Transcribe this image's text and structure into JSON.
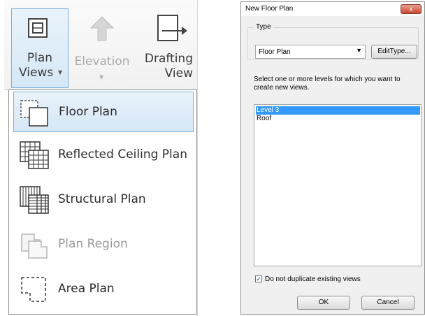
{
  "ribbon": {
    "plan_views": {
      "line1": "Plan",
      "line2": "Views"
    },
    "elevation": {
      "label": "Elevation"
    },
    "drafting_view": {
      "line1": "Drafting",
      "line2": "View"
    }
  },
  "dropdown": {
    "items": [
      {
        "label": "Floor Plan",
        "icon": "floor-plan-icon",
        "state": "selected"
      },
      {
        "label": "Reflected Ceiling Plan",
        "icon": "reflected-ceiling-plan-icon",
        "state": "normal"
      },
      {
        "label": "Structural Plan",
        "icon": "structural-plan-icon",
        "state": "normal"
      },
      {
        "label": "Plan Region",
        "icon": "plan-region-icon",
        "state": "disabled"
      },
      {
        "label": "Area Plan",
        "icon": "area-plan-icon",
        "state": "normal"
      }
    ]
  },
  "dialog": {
    "title": "New Floor Plan",
    "close_symbol": "x",
    "type_group_label": "Type",
    "type_select_value": "Floor Plan",
    "edit_type_button": "EditType...",
    "instructions": "Select one or more levels for which you want to create new views.",
    "levels": [
      {
        "label": "Level 3",
        "selected": true
      },
      {
        "label": "Roof",
        "selected": false
      }
    ],
    "checkbox_label": "Do not duplicate existing views",
    "checkbox_checked": true,
    "ok_button": "OK",
    "cancel_button": "Cancel"
  },
  "colors": {
    "selection_blue": "#3399ff",
    "ribbon_highlight": "#d5e8f6",
    "close_red": "#c94a33"
  }
}
